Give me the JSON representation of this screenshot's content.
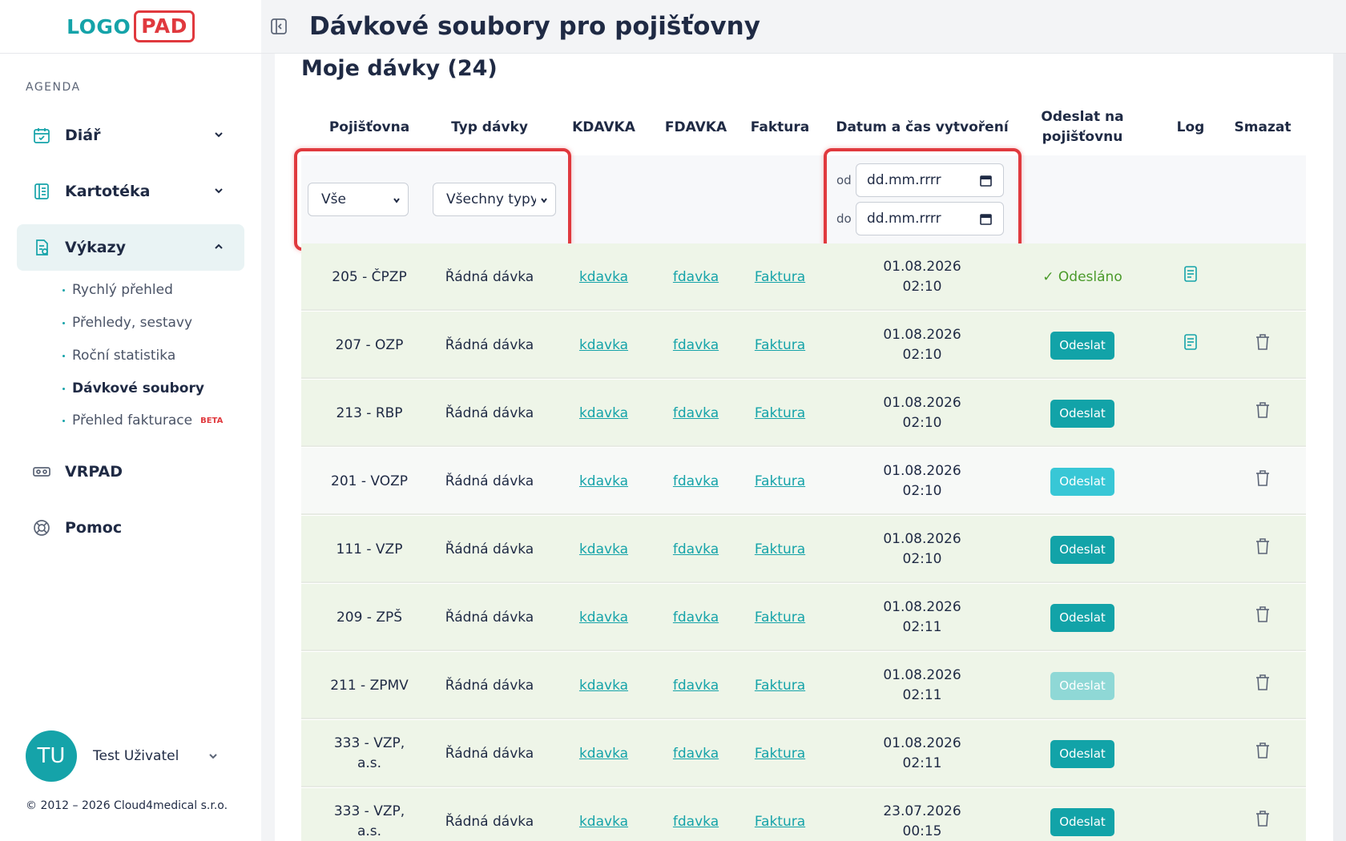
{
  "logo": {
    "part1": "LOGO",
    "part2": "PAD"
  },
  "sidebar": {
    "section": "AGENDA",
    "items": [
      {
        "label": "Diář"
      },
      {
        "label": "Kartotéka"
      },
      {
        "label": "Výkazy"
      },
      {
        "label": "VRPAD"
      },
      {
        "label": "Pomoc"
      }
    ],
    "subitems": [
      {
        "label": "Rychlý přehled"
      },
      {
        "label": "Přehledy, sestavy"
      },
      {
        "label": "Roční statistika"
      },
      {
        "label": "Dávkové soubory"
      },
      {
        "label": "Přehled fakturace"
      }
    ],
    "beta": "BETA",
    "user": {
      "initials": "TU",
      "name": "Test Uživatel"
    },
    "copyright": "© 2012 – 2026 Cloud4medical s.r.o."
  },
  "header": {
    "title": "Dávkové soubory pro pojišťovny"
  },
  "main": {
    "section_title": "Moje dávky (24)",
    "columns": [
      "Pojišťovna",
      "Typ dávky",
      "KDAVKA",
      "FDAVKA",
      "Faktura",
      "Datum a čas vytvoření",
      "Odeslat na pojišťovnu",
      "Log",
      "Smazat"
    ],
    "filters": {
      "insurer": "Vše",
      "type": "Všechny typy",
      "from_label": "od",
      "to_label": "do",
      "from_placeholder": "dd.mm.rrrr",
      "to_placeholder": "dd.mm.rrrr"
    },
    "rows": [
      {
        "insurer": "205 - ČPZP",
        "type": "Řádná dávka",
        "kdavka": "kdavka",
        "fdavka": "fdavka",
        "faktura": "Faktura",
        "date": "01.08.2026",
        "time": "02:10",
        "status": "✓ Odesláno"
      },
      {
        "insurer": "207 - OZP",
        "type": "Řádná dávka",
        "kdavka": "kdavka",
        "fdavka": "fdavka",
        "faktura": "Faktura",
        "date": "01.08.2026",
        "time": "02:10",
        "action": "Odeslat"
      },
      {
        "insurer": "213 - RBP",
        "type": "Řádná dávka",
        "kdavka": "kdavka",
        "fdavka": "fdavka",
        "faktura": "Faktura",
        "date": "01.08.2026",
        "time": "02:10",
        "action": "Odeslat"
      },
      {
        "insurer": "201 - VOZP",
        "type": "Řádná dávka",
        "kdavka": "kdavka",
        "fdavka": "fdavka",
        "faktura": "Faktura",
        "date": "01.08.2026",
        "time": "02:10",
        "action": "Odeslat"
      },
      {
        "insurer": "111 - VZP",
        "type": "Řádná dávka",
        "kdavka": "kdavka",
        "fdavka": "fdavka",
        "faktura": "Faktura",
        "date": "01.08.2026",
        "time": "02:10",
        "action": "Odeslat"
      },
      {
        "insurer": "209 - ZPŠ",
        "type": "Řádná dávka",
        "kdavka": "kdavka",
        "fdavka": "fdavka",
        "faktura": "Faktura",
        "date": "01.08.2026",
        "time": "02:11",
        "action": "Odeslat"
      },
      {
        "insurer": "211 - ZPMV",
        "type": "Řádná dávka",
        "kdavka": "kdavka",
        "fdavka": "fdavka",
        "faktura": "Faktura",
        "date": "01.08.2026",
        "time": "02:11",
        "action": "Odeslat"
      },
      {
        "insurer": "333 - VZP, a.s.",
        "type": "Řádná dávka",
        "kdavka": "kdavka",
        "fdavka": "fdavka",
        "faktura": "Faktura",
        "date": "01.08.2026",
        "time": "02:11",
        "action": "Odeslat"
      },
      {
        "insurer": "333 - VZP, a.s.",
        "type": "Řádná dávka",
        "kdavka": "kdavka",
        "fdavka": "fdavka",
        "faktura": "Faktura",
        "date": "23.07.2026",
        "time": "00:15",
        "action": "Odeslat"
      }
    ]
  },
  "colors": {
    "accent": "#15a3a9",
    "highlight": "#e0393e",
    "sent": "#4a9a2a"
  }
}
